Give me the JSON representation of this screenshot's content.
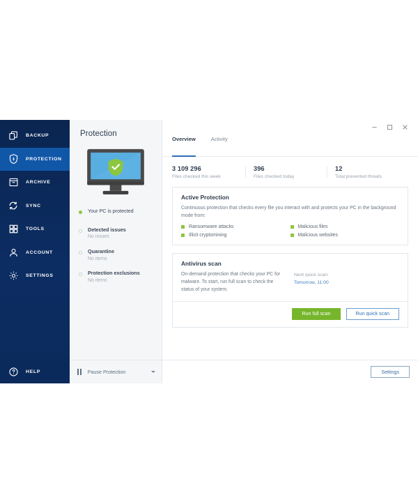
{
  "window": {
    "controls": {
      "minimize": "minimize-icon",
      "maximize": "maximize-icon",
      "close": "close-icon"
    }
  },
  "sidebar": {
    "items": [
      {
        "label": "BACKUP",
        "icon": "backup-copies-icon",
        "active": false
      },
      {
        "label": "PROTECTION",
        "icon": "shield-icon",
        "active": true
      },
      {
        "label": "ARCHIVE",
        "icon": "archive-box-icon",
        "active": false
      },
      {
        "label": "SYNC",
        "icon": "sync-arrows-icon",
        "active": false
      },
      {
        "label": "TOOLS",
        "icon": "grid-squares-icon",
        "active": false
      },
      {
        "label": "ACCOUNT",
        "icon": "person-icon",
        "active": false
      },
      {
        "label": "SETTINGS",
        "icon": "gear-icon",
        "active": false
      }
    ],
    "help": {
      "label": "HELP",
      "icon": "question-circle-icon"
    }
  },
  "mid_panel": {
    "title": "Protection",
    "illustration": "monitor-with-shield-illustration",
    "protected_status": "Your PC is protected",
    "status_groups": [
      {
        "title": "Detected issues",
        "value": "No issues"
      },
      {
        "title": "Quarantine",
        "value": "No items"
      },
      {
        "title": "Protection exclusions",
        "value": "No items"
      }
    ],
    "pause": {
      "label": "Pause Protection",
      "icon": "pause-icon",
      "chevron": "chevron-down-icon"
    }
  },
  "main": {
    "tabs": [
      {
        "label": "Overview",
        "active": true
      },
      {
        "label": "Activity",
        "active": false
      }
    ],
    "stats": [
      {
        "value": "3 109 296",
        "caption": "Files checked this week"
      },
      {
        "value": "396",
        "caption": "Files checked today"
      },
      {
        "value": "12",
        "caption": "Total prevented threats"
      }
    ],
    "active_protection": {
      "title": "Active Protection",
      "description": "Continuous protection that checks every file you interact with and protects your PC in the background mode from:",
      "bullets": [
        "Ransomware attacks",
        "Malicious files",
        "Illicit cryptomining",
        "Malicious websites"
      ]
    },
    "antivirus_scan": {
      "title": "Antivirus scan",
      "description": "On-demand protection that checks your PC for malware. To start, run full scan to check the status of your system.",
      "next_scan_label": "Next quick scan:",
      "next_scan_time": "Tomorrow, 11:00",
      "full_scan_button": "Run full scan",
      "quick_scan_button": "Run quick scan"
    },
    "footer": {
      "settings_button": "Settings"
    }
  },
  "colors": {
    "sidebar_bg": "#0b2a5b",
    "sidebar_active": "#1157a8",
    "accent_blue": "#2f6fb5",
    "accent_green": "#76b62c",
    "status_green": "#8cc63e",
    "panel_bg": "#f4f6f8"
  }
}
